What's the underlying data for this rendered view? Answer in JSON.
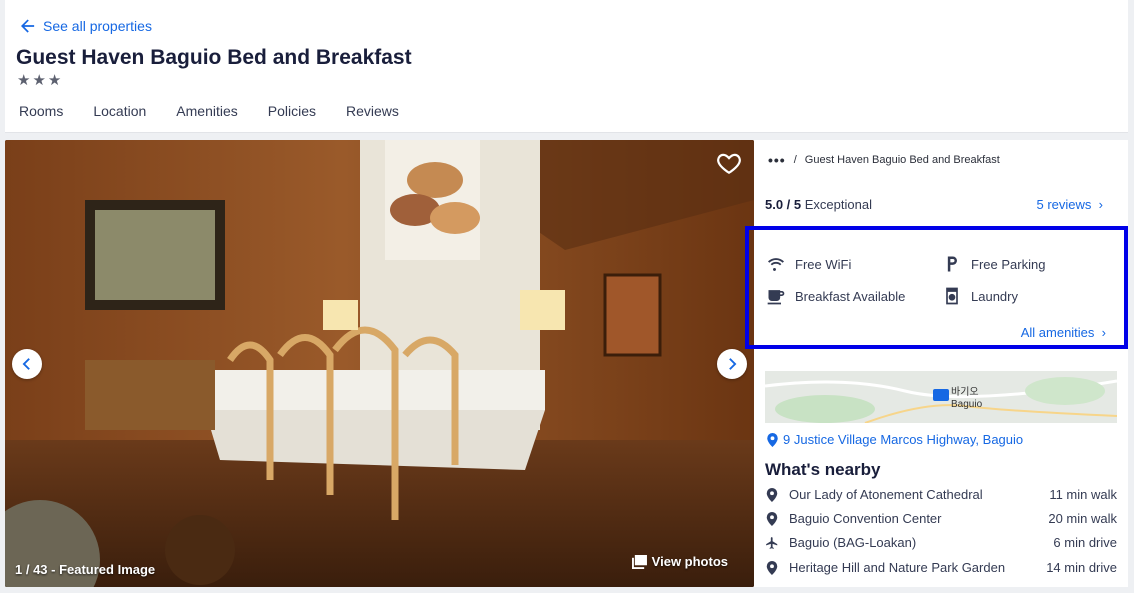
{
  "header": {
    "back_label": "See all properties",
    "title": "Guest Haven Baguio Bed and Breakfast",
    "star_count": 3,
    "tabs": [
      "Rooms",
      "Location",
      "Amenities",
      "Policies",
      "Reviews"
    ]
  },
  "gallery": {
    "counter": "1 / 43 - Featured Image",
    "view_photos": "View photos"
  },
  "breadcrumb": {
    "current": "Guest Haven Baguio Bed and Breakfast"
  },
  "rating": {
    "score": "5.0 / 5",
    "label": "Exceptional",
    "reviews_link": "5 reviews"
  },
  "amenities": {
    "items": [
      {
        "label": "Free WiFi",
        "icon": "wifi-icon"
      },
      {
        "label": "Free Parking",
        "icon": "parking-icon"
      },
      {
        "label": "Breakfast Available",
        "icon": "coffee-icon"
      },
      {
        "label": "Laundry",
        "icon": "laundry-icon"
      }
    ],
    "all_link": "All amenities"
  },
  "location": {
    "map_label": "Baguio",
    "map_label_kr": "바기오",
    "address": "9 Justice Village Marcos Highway, Baguio"
  },
  "nearby": {
    "title": "What's nearby",
    "items": [
      {
        "name": "Our Lady of Atonement Cathedral",
        "distance": "11 min walk",
        "icon": "map-pin-icon"
      },
      {
        "name": "Baguio Convention Center",
        "distance": "20 min walk",
        "icon": "map-pin-icon"
      },
      {
        "name": "Baguio (BAG-Loakan)",
        "distance": "6 min drive",
        "icon": "airplane-icon"
      },
      {
        "name": "Heritage Hill and Nature Park Garden",
        "distance": "14 min drive",
        "icon": "map-pin-icon"
      }
    ]
  },
  "colors": {
    "link": "#1668e3",
    "highlight_border": "#0000e8",
    "heading": "#191e3b"
  }
}
